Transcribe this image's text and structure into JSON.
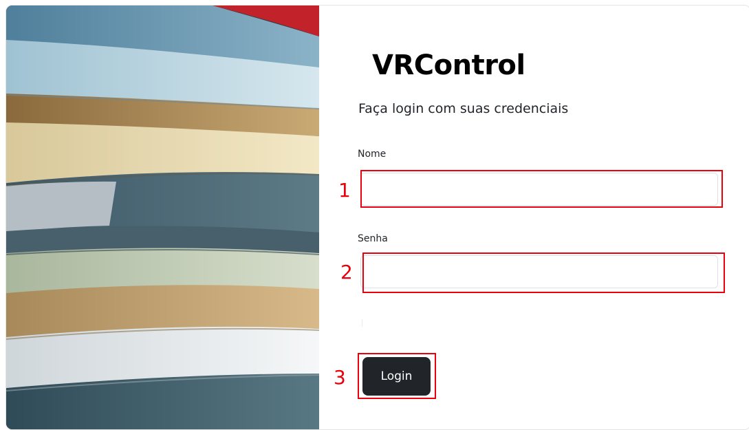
{
  "app": {
    "title": "VRControl",
    "subtitle": "Faça login com suas credenciais"
  },
  "form": {
    "nome": {
      "label": "Nome",
      "value": "",
      "placeholder": ""
    },
    "senha": {
      "label": "Senha",
      "value": "",
      "placeholder": ""
    },
    "login_button": {
      "label": "Login"
    }
  },
  "annotations": {
    "step_1": "1",
    "step_2": "2",
    "step_3": "3",
    "highlight_color": "#e8000b"
  },
  "theme": {
    "button_bg": "#212529",
    "button_text": "#ffffff",
    "text_color": "#212529"
  },
  "image": {
    "icon": "folded-clothes-photo"
  }
}
